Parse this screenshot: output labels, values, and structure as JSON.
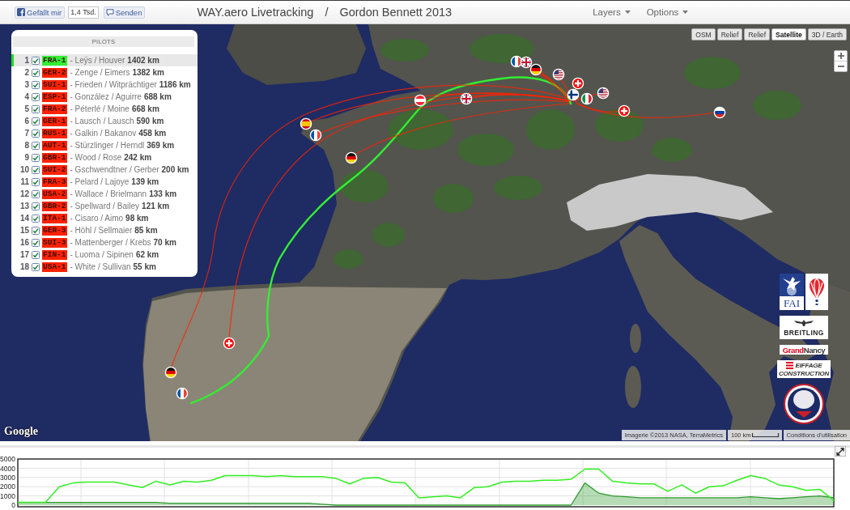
{
  "header": {
    "like_button": "Gefällt mir",
    "like_count": "1,4 Tsd.",
    "send_button": "Senden",
    "title": "WAY.aero Livetracking",
    "separator": "/",
    "subtitle": "Gordon Bennett 2013",
    "menus": [
      {
        "label": "Layers"
      },
      {
        "label": "Options"
      }
    ]
  },
  "pilots_panel": {
    "title": "PILOTS",
    "pilots": [
      {
        "rank": "1",
        "checked": true,
        "team": "FRA-1",
        "crew": "- Leÿs / Houver",
        "distance": "1402 km",
        "color": "#33ee33",
        "selected": true
      },
      {
        "rank": "2",
        "checked": true,
        "team": "GER-2",
        "crew": "- Zenge / Eimers",
        "distance": "1382 km",
        "color": "#ff2200",
        "selected": false
      },
      {
        "rank": "3",
        "checked": true,
        "team": "SUI-1",
        "crew": "- Frieden / Witprächtiger",
        "distance": "1186 km",
        "color": "#ff2200",
        "selected": false
      },
      {
        "rank": "4",
        "checked": true,
        "team": "ESP-1",
        "crew": "- González / Aguirre",
        "distance": "688 km",
        "color": "#ff2200",
        "selected": false
      },
      {
        "rank": "5",
        "checked": true,
        "team": "FRA-2",
        "crew": "- Péterlé / Moine",
        "distance": "668 km",
        "color": "#ff2200",
        "selected": false
      },
      {
        "rank": "6",
        "checked": true,
        "team": "GER-1",
        "crew": "- Lausch / Lausch",
        "distance": "590 km",
        "color": "#ff2200",
        "selected": false
      },
      {
        "rank": "7",
        "checked": true,
        "team": "RUS-1",
        "crew": "- Galkin / Bakanov",
        "distance": "458 km",
        "color": "#ff2200",
        "selected": false
      },
      {
        "rank": "8",
        "checked": true,
        "team": "AUT-1",
        "crew": "- Stürzlinger / Herndl",
        "distance": "369 km",
        "color": "#ff2200",
        "selected": false
      },
      {
        "rank": "9",
        "checked": true,
        "team": "GBR-1",
        "crew": "- Wood / Rose",
        "distance": "242 km",
        "color": "#ff2200",
        "selected": false
      },
      {
        "rank": "10",
        "checked": true,
        "team": "SUI-2",
        "crew": "- Gschwendtner / Gerber",
        "distance": "200 km",
        "color": "#ff2200",
        "selected": false
      },
      {
        "rank": "11",
        "checked": true,
        "team": "FRA-3",
        "crew": "- Pelard / Lajoye",
        "distance": "139 km",
        "color": "#ff2200",
        "selected": false
      },
      {
        "rank": "12",
        "checked": true,
        "team": "USA-2",
        "crew": "- Wallace / Brielmann",
        "distance": "133 km",
        "color": "#ff2200",
        "selected": false
      },
      {
        "rank": "13",
        "checked": true,
        "team": "GBR-2",
        "crew": "- Spellward / Bailey",
        "distance": "121 km",
        "color": "#ff2200",
        "selected": false
      },
      {
        "rank": "14",
        "checked": true,
        "team": "ITA-1",
        "crew": "- Cisaro / Aimo",
        "distance": "98 km",
        "color": "#ff2200",
        "selected": false
      },
      {
        "rank": "15",
        "checked": true,
        "team": "GER-3",
        "crew": "- Höhl / Sellmaier",
        "distance": "85 km",
        "color": "#ff2200",
        "selected": false
      },
      {
        "rank": "16",
        "checked": true,
        "team": "SUI-3",
        "crew": "- Mattenberger / Krebs",
        "distance": "70 km",
        "color": "#ff2200",
        "selected": false
      },
      {
        "rank": "17",
        "checked": true,
        "team": "FIN-1",
        "crew": "- Luoma / Sipinen",
        "distance": "62 km",
        "color": "#ff2200",
        "selected": false
      },
      {
        "rank": "18",
        "checked": true,
        "team": "USA-1",
        "crew": "- White / Sullivan",
        "distance": "55 km",
        "color": "#ff2200",
        "selected": false
      }
    ]
  },
  "map": {
    "map_types": [
      {
        "label": "OSM",
        "selected": false
      },
      {
        "label": "Relief",
        "selected": false
      },
      {
        "label": "Relief",
        "selected": false
      },
      {
        "label": "Satellite",
        "selected": true
      },
      {
        "label": "3D / Earth",
        "selected": false
      }
    ],
    "sponsors": [
      {
        "kind": "fai",
        "text": "FAI"
      },
      {
        "kind": "balloon"
      },
      {
        "kind": "wings",
        "text": "BREITLING"
      },
      {
        "kind": "two_tone",
        "words": [
          "Grand",
          "Nancy"
        ]
      },
      {
        "kind": "stripes",
        "words": [
          "EIFFAGE",
          "CONSTRUCTION"
        ]
      },
      {
        "kind": "emblem"
      }
    ],
    "logo": "Google",
    "attribution": "Imagerie ©2013 NASA, TerraMetrics",
    "scale": "100 km",
    "terms": "Conditions d'utilisation"
  },
  "altitude_chart": {
    "chart_data": {
      "type": "line",
      "grid": true,
      "ylim": [
        0,
        5000
      ],
      "yticks": [
        0,
        1000,
        2000,
        3000,
        4000,
        5000
      ],
      "series": [
        {
          "type": "line",
          "color": "#33ee22",
          "values": [
            300,
            300,
            300,
            2000,
            2400,
            2500,
            2500,
            2500,
            2200,
            1900,
            2600,
            2200,
            2600,
            2500,
            2700,
            3200,
            3200,
            3200,
            3100,
            3200,
            3100,
            3100,
            3100,
            2900,
            2300,
            2900,
            3000,
            2500,
            2400,
            800,
            900,
            1000,
            800,
            1900,
            2000,
            2500,
            2600,
            2600,
            2700,
            2700,
            2800,
            3900,
            3900,
            2600,
            2400,
            2300,
            2300,
            1500,
            2200,
            1300,
            2000,
            2100,
            2700,
            3200,
            2900,
            2200,
            2000,
            1600,
            1700,
            500
          ]
        },
        {
          "type": "area",
          "color": "#2f9a2f",
          "values": [
            300,
            300,
            300,
            300,
            300,
            300,
            300,
            300,
            300,
            300,
            300,
            200,
            200,
            200,
            200,
            200,
            200,
            200,
            200,
            200,
            200,
            200,
            100,
            0,
            0,
            0,
            0,
            0,
            0,
            0,
            0,
            0,
            0,
            0,
            0,
            0,
            0,
            0,
            0,
            0,
            0,
            2400,
            1300,
            1000,
            900,
            800,
            800,
            800,
            800,
            800,
            800,
            800,
            800,
            900,
            800,
            700,
            800,
            900,
            1000,
            800
          ]
        }
      ]
    }
  }
}
